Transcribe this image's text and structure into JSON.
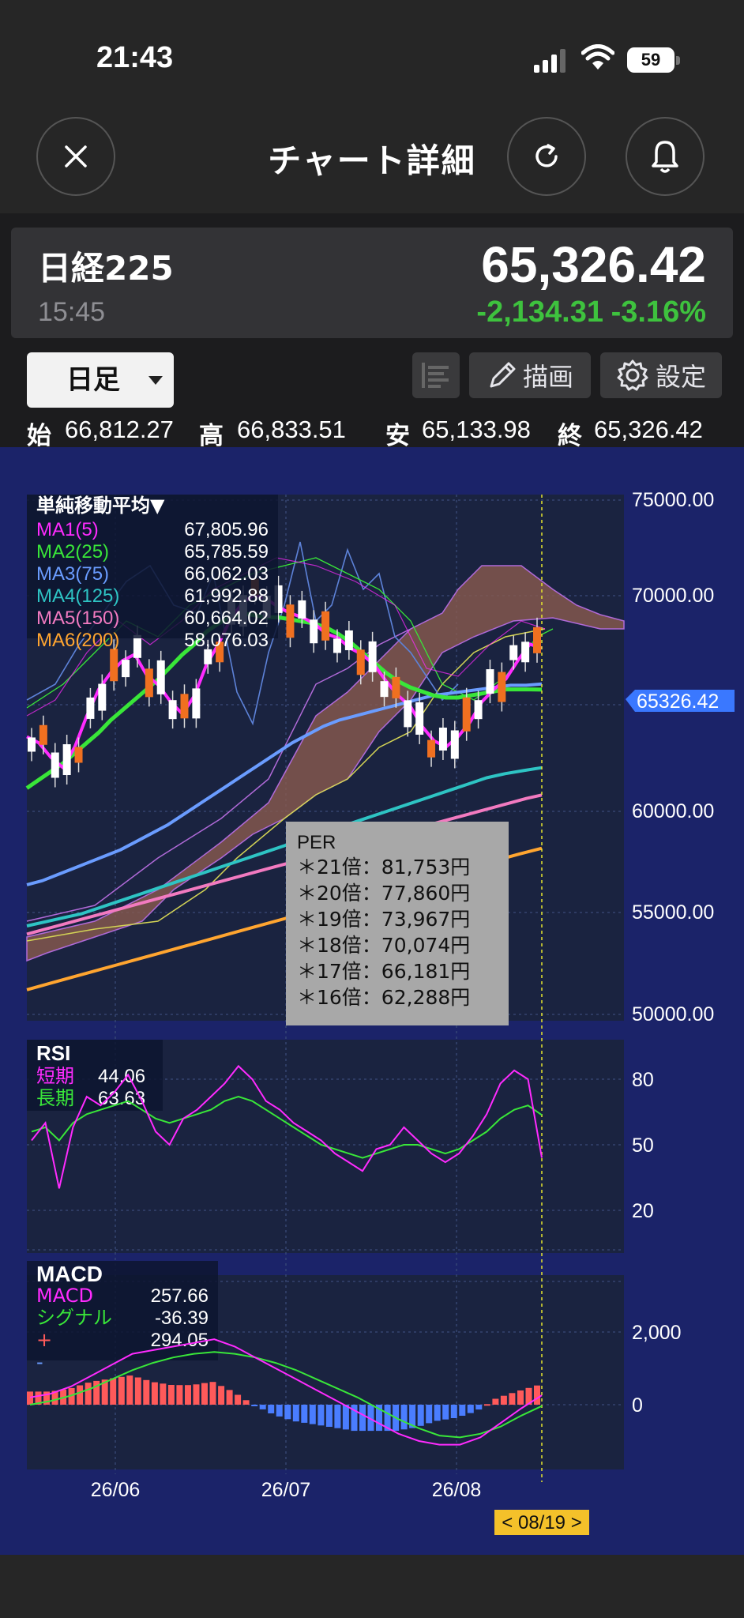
{
  "status": {
    "time": "21:43",
    "battery": "59"
  },
  "header": {
    "title": "チャート詳細"
  },
  "quote": {
    "name": "日経225",
    "time": "15:45",
    "price": "65,326.42",
    "change": "-2,134.31",
    "change_pct": "-3.16%",
    "down_color": "#3ec23e"
  },
  "toolbar": {
    "period": "日足",
    "draw": "描画",
    "settings": "設定"
  },
  "ohlc": [
    {
      "key": "始",
      "value": "66,812.27"
    },
    {
      "key": "高",
      "value": "66,833.51"
    },
    {
      "key": "安",
      "value": "65,133.98"
    },
    {
      "key": "終",
      "value": "65,326.42"
    }
  ],
  "legend": {
    "title": "単純移動平均▼",
    "items": [
      {
        "name": "MA1(5)",
        "value": "67,805.96",
        "color": "#ff2bff"
      },
      {
        "name": "MA2(25)",
        "value": "65,785.59",
        "color": "#39e639"
      },
      {
        "name": "MA3(75)",
        "value": "66,062.03",
        "color": "#6a9cff"
      },
      {
        "name": "MA4(125)",
        "value": "61,992.88",
        "color": "#2ec4c4"
      },
      {
        "name": "MA5(150)",
        "value": "60,664.02",
        "color": "#f27ac0"
      },
      {
        "name": "MA6(200)",
        "value": "58,076.03",
        "color": "#ffa530"
      }
    ]
  },
  "per": {
    "title": "PER",
    "lines": [
      "＊21倍：81,753円",
      "＊20倍：77,860円",
      "＊19倍：73,967円",
      "＊18倍：70,074円",
      "＊17倍：66,181円",
      "＊16倍：62,288円"
    ]
  },
  "price_axis": [
    "75000.00",
    "70000.00",
    "60000.00",
    "55000.00",
    "50000.00"
  ],
  "current_tag": "65326.42",
  "rsi": {
    "title": "RSI",
    "items": [
      {
        "name": "短期",
        "value": "44.06",
        "color": "#ff2bff"
      },
      {
        "name": "長期",
        "value": "63.63",
        "color": "#39e639"
      }
    ],
    "axis": [
      "80",
      "50",
      "20"
    ]
  },
  "macd": {
    "title": "MACD",
    "items": [
      {
        "name": "MACD",
        "value": "257.66",
        "color": "#ff2bff"
      },
      {
        "name": "シグナル",
        "value": "-36.39",
        "color": "#39e639"
      },
      {
        "name": "+",
        "value": "294.05",
        "color": "#ff5a5a"
      },
      {
        "name": "-",
        "value": "",
        "color": "#6a9cff"
      }
    ],
    "axis": [
      "2,000",
      "0"
    ]
  },
  "x_axis": [
    "26/06",
    "26/07",
    "26/08"
  ],
  "cursor_date": "< 08/19 >",
  "chart_data": {
    "type": "line",
    "price_ylim": [
      50000,
      75000
    ],
    "ma1": [
      63500,
      63200,
      62500,
      62000,
      63000,
      64500,
      65800,
      66600,
      67200,
      67500,
      66500,
      66000,
      65200,
      64600,
      65500,
      67000,
      68000,
      69200,
      70000,
      70400,
      70200,
      69800,
      69500,
      69300,
      69000,
      68500,
      68300,
      67800,
      67500,
      67000,
      66200,
      65500,
      65000,
      64000,
      63300,
      63000,
      63500,
      64200,
      65200,
      65800,
      66300,
      67200,
      68000,
      67805.96
    ],
    "ma2": [
      61000,
      61400,
      61800,
      62200,
      62700,
      63200,
      63700,
      64300,
      64800,
      65300,
      65800,
      66300,
      66900,
      67500,
      68000,
      68600,
      69000,
      69300,
      69500,
      69400,
      69300,
      69300,
      69200,
      69100,
      69000,
      68800,
      68500,
      68100,
      67600,
      67100,
      66600,
      66200,
      65900,
      65700,
      65500,
      65400,
      65400,
      65500,
      65600,
      65700,
      65800,
      65800,
      65800,
      65785.59
    ],
    "ma3": [
      56300,
      56500,
      56800,
      57100,
      57400,
      57700,
      58000,
      58400,
      58800,
      59200,
      59700,
      60200,
      60700,
      61200,
      61700,
      62200,
      62700,
      63200,
      63600,
      64000,
      64300,
      64500,
      64700,
      64900,
      65100,
      65300,
      65500,
      65600,
      65700,
      65800,
      65900,
      66000,
      66000,
      66062.03
    ],
    "ma4": [
      54300,
      54500,
      54700,
      54900,
      55200,
      55500,
      55800,
      56100,
      56400,
      56700,
      57000,
      57300,
      57600,
      57900,
      58200,
      58500,
      58800,
      59100,
      59400,
      59700,
      60000,
      60300,
      60600,
      60900,
      61200,
      61500,
      61700,
      61850,
      61992.88
    ],
    "ma5": [
      53900,
      54100,
      54300,
      54500,
      54700,
      54900,
      55100,
      55300,
      55500,
      55700,
      55900,
      56100,
      56300,
      56500,
      56700,
      56900,
      57100,
      57300,
      57500,
      57700,
      57900,
      58100,
      58300,
      58500,
      58700,
      58900,
      59100,
      59300,
      59500,
      59700,
      59900,
      60100,
      60300,
      60500,
      60664.02
    ],
    "ma6": [
      51200,
      51500,
      51800,
      52100,
      52400,
      52700,
      53000,
      53300,
      53600,
      53900,
      54200,
      54500,
      54800,
      55100,
      55400,
      55700,
      56000,
      56300,
      56600,
      56900,
      57200,
      57500,
      57800,
      58076.03
    ],
    "rsi_short": [
      52,
      60,
      30,
      58,
      72,
      68,
      74,
      82,
      70,
      56,
      50,
      62,
      66,
      72,
      78,
      86,
      80,
      70,
      66,
      60,
      56,
      52,
      46,
      42,
      38,
      48,
      50,
      58,
      52,
      46,
      42,
      46,
      54,
      64,
      78,
      84,
      80,
      44.06
    ],
    "rsi_long": [
      56,
      58,
      52,
      60,
      64,
      66,
      68,
      70,
      66,
      62,
      60,
      62,
      64,
      66,
      70,
      72,
      70,
      66,
      62,
      58,
      54,
      50,
      48,
      46,
      44,
      46,
      48,
      50,
      50,
      48,
      46,
      48,
      52,
      56,
      62,
      66,
      68,
      63.63
    ],
    "macd_line": [
      200,
      300,
      500,
      800,
      1100,
      1400,
      1500,
      1600,
      1700,
      1800,
      1600,
      1300,
      1000,
      700,
      400,
      100,
      -200,
      -500,
      -800,
      -1000,
      -1100,
      -1100,
      -900,
      -500,
      -100,
      257.66
    ],
    "signal_line": [
      0,
      100,
      250,
      450,
      700,
      950,
      1150,
      1300,
      1400,
      1450,
      1400,
      1300,
      1150,
      950,
      700,
      450,
      200,
      -100,
      -400,
      -650,
      -850,
      -900,
      -800,
      -600,
      -300,
      -36.39
    ]
  }
}
